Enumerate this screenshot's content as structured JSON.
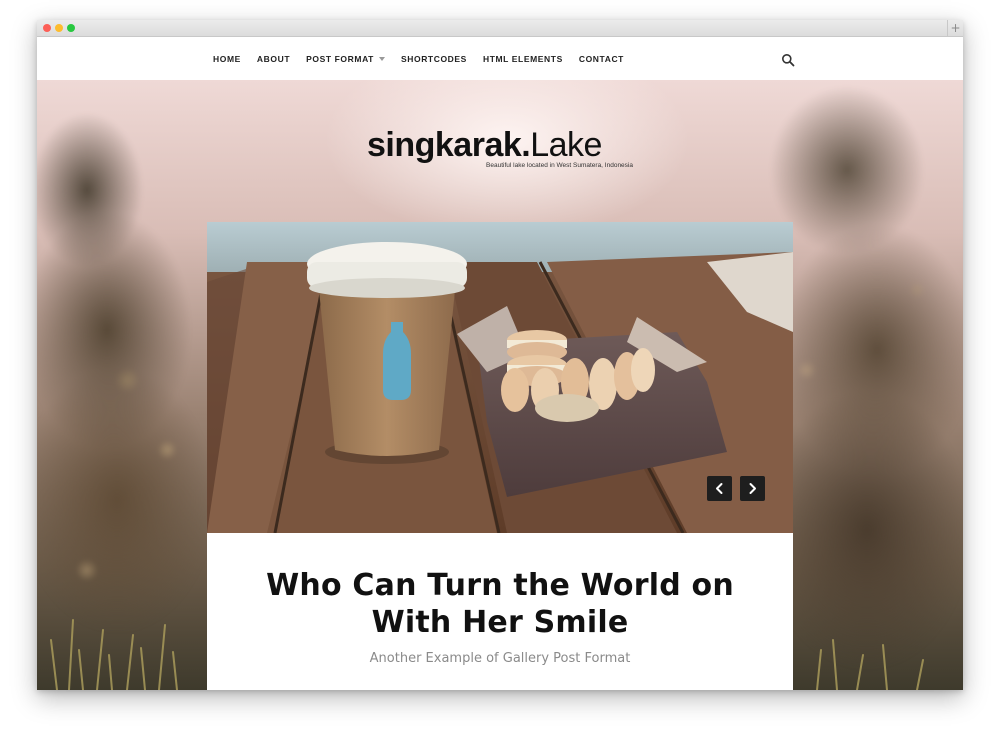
{
  "browser": {
    "new_tab_label": "+"
  },
  "nav": {
    "items": [
      {
        "label": "HOME"
      },
      {
        "label": "ABOUT"
      },
      {
        "label": "POST FORMAT"
      },
      {
        "label": "SHORTCODES"
      },
      {
        "label": "HTML ELEMENTS"
      },
      {
        "label": "CONTACT"
      }
    ],
    "search_icon": "search-icon"
  },
  "site": {
    "title_bold": "singkarak.",
    "title_light": "Lake",
    "tagline": "Beautiful lake located in West Sumatera, Indonesia"
  },
  "post": {
    "title": "Who Can Turn the World on With Her Smile",
    "subtitle": "Another Example of Gallery Post Format",
    "gallery": {
      "prev_icon": "chevron-left-icon",
      "next_icon": "chevron-right-icon"
    }
  },
  "colors": {
    "nav_text": "#222222",
    "slider_button": "#1e1e1e",
    "subtitle": "#8a8a8a"
  }
}
